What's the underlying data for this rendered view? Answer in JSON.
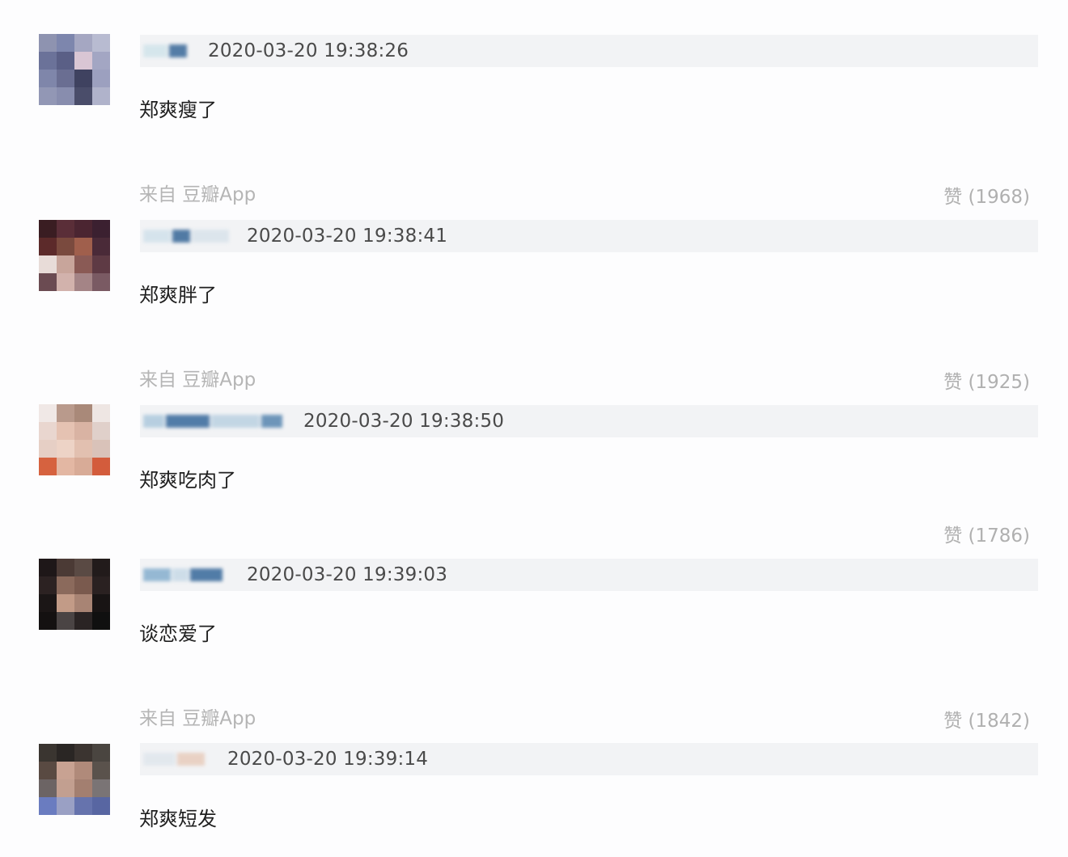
{
  "comments": [
    {
      "timestamp": "2020-03-20 19:38:26",
      "text": "郑爽瘦了",
      "source": "来自 豆瓣App",
      "likes": "赞 (1968)"
    },
    {
      "timestamp": "2020-03-20 19:38:41",
      "text": "郑爽胖了",
      "source": "来自 豆瓣App",
      "likes": "赞 (1925)"
    },
    {
      "timestamp": "2020-03-20 19:38:50",
      "text": "郑爽吃肉了",
      "source": "",
      "likes": "赞 (1786)"
    },
    {
      "timestamp": "2020-03-20 19:39:03",
      "text": "谈恋爱了",
      "source": "来自 豆瓣App",
      "likes": "赞 (1842)"
    },
    {
      "timestamp": "2020-03-20 19:39:14",
      "text": "郑爽短发",
      "source": "",
      "likes": ""
    }
  ],
  "colors": {
    "meta_bar": "#f2f3f5",
    "comment_text": "#1f1f1f",
    "muted_text": "#b5b5b5",
    "timestamp_text": "#4a4a4a"
  }
}
